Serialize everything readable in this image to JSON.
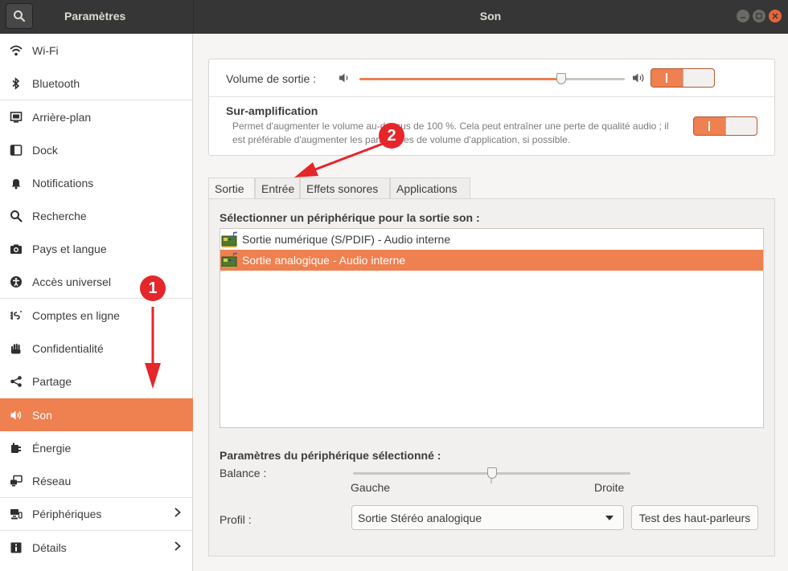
{
  "window": {
    "sidebar_title": "Paramètres",
    "main_title": "Son"
  },
  "sidebar": {
    "items": [
      {
        "label": "Wi-Fi",
        "icon": "wifi-icon"
      },
      {
        "label": "Bluetooth",
        "icon": "bluetooth-icon"
      },
      {
        "label": "Arrière-plan",
        "icon": "background-icon"
      },
      {
        "label": "Dock",
        "icon": "dock-icon"
      },
      {
        "label": "Notifications",
        "icon": "bell-icon"
      },
      {
        "label": "Recherche",
        "icon": "search-icon"
      },
      {
        "label": "Pays et langue",
        "icon": "camera-icon"
      },
      {
        "label": "Accès universel",
        "icon": "accessibility-icon"
      },
      {
        "label": "Comptes en ligne",
        "icon": "online-accounts-icon"
      },
      {
        "label": "Confidentialité",
        "icon": "hand-icon"
      },
      {
        "label": "Partage",
        "icon": "share-icon"
      },
      {
        "label": "Son",
        "icon": "speaker-icon",
        "active": true
      },
      {
        "label": "Énergie",
        "icon": "power-icon"
      },
      {
        "label": "Réseau",
        "icon": "network-icon"
      },
      {
        "label": "Périphériques",
        "icon": "devices-icon",
        "has_submenu": true
      },
      {
        "label": "Détails",
        "icon": "info-icon",
        "has_submenu": true
      }
    ]
  },
  "output_volume": {
    "label": "Volume de sortie :",
    "level": 0.76,
    "toggle_on": true
  },
  "amplification": {
    "title": "Sur-amplification",
    "description": "Permet d'augmenter le volume au-dessus de 100 %. Cela peut entraîner une perte de qualité audio ; il est préférable d'augmenter les paramètres de volume d'application, si possible.",
    "toggle_on": true
  },
  "tabs": [
    {
      "label": "Sortie",
      "active": true
    },
    {
      "label": "Entrée"
    },
    {
      "label": "Effets sonores"
    },
    {
      "label": "Applications"
    }
  ],
  "output": {
    "device_section_title": "Sélectionner un périphérique pour la sortie son :",
    "devices": [
      {
        "label": "Sortie numérique (S/PDIF) - Audio interne",
        "selected": false
      },
      {
        "label": "Sortie analogique - Audio interne",
        "selected": true
      }
    ],
    "settings_title": "Paramètres du périphérique sélectionné :",
    "balance_label": "Balance :",
    "balance_left": "Gauche",
    "balance_right": "Droite",
    "balance_value": 0.5,
    "profile_label": "Profil :",
    "profile_value": "Sortie Stéréo analogique",
    "test_button": "Test des haut-parleurs"
  },
  "annotations": {
    "callout_1": "1",
    "callout_2": "2"
  },
  "colors": {
    "accent": "#ef8050",
    "titlebar": "#363636",
    "callout": "#e5262a"
  }
}
